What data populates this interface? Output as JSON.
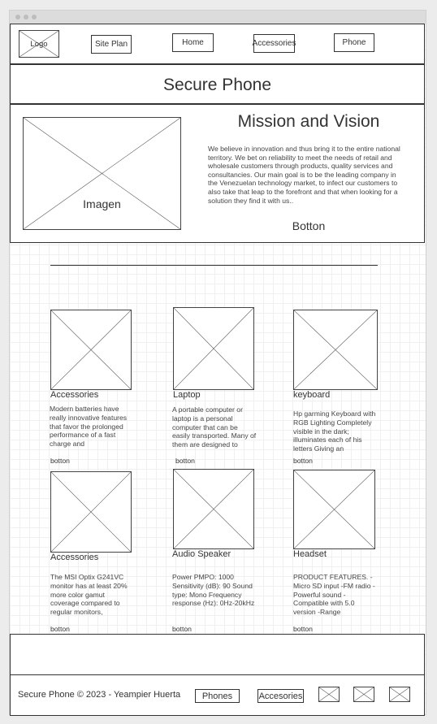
{
  "header": {
    "logo_label": "Logo",
    "nav": [
      "Site Plan",
      "Home",
      "Accessories",
      "Phone"
    ]
  },
  "hero": {
    "title": "Secure Phone"
  },
  "mission": {
    "image_label": "Imagen",
    "title": "Mission and Vision",
    "text": "We believe in innovation and thus bring it to the entire national territory. We bet on reliability to meet the needs of retail and wholesale customers through products, quality services and consultancies. Our main goal is to be the leading company in the Venezuelan technology market, to infect our customers to also take that leap to the forefront and that when looking for a solution they find it with us..",
    "button": "Botton"
  },
  "products": [
    {
      "title": "Accessories",
      "text": "Modern batteries have really innovative features that favor the prolonged performance of a fast charge and",
      "button": "botton"
    },
    {
      "title": "Laptop",
      "text": "A portable computer or laptop is a personal computer that can be easily transported. Many of them are designed to",
      "button": "botton"
    },
    {
      "title": "keyboard",
      "text": "Hp garming Keyboard with RGB Lighting Completely visible in the dark; illuminates each of his letters Giving an",
      "button": "botton"
    },
    {
      "title": "Accessories",
      "text": "The MSI Optix G241VC monitor has at least 20% more color gamut coverage compared to regular monitors,",
      "button": "botton"
    },
    {
      "title": "Audio Speaker",
      "text": "Power PMPO: 1000 Sensitivity (dB): 90 Sound type: Mono Frequency response (Hz): 0Hz-20kHz",
      "button": "botton"
    },
    {
      "title": "Headset",
      "text": "PRODUCT FEATURES. -Micro SD input -FM radio -Powerful sound -Compatible with 5.0 version -Range",
      "button": "botton"
    }
  ],
  "footer": {
    "copyright": "Secure Phone © 2023 - Yeampier Huerta",
    "links": [
      "Phones",
      "Accesories"
    ]
  }
}
